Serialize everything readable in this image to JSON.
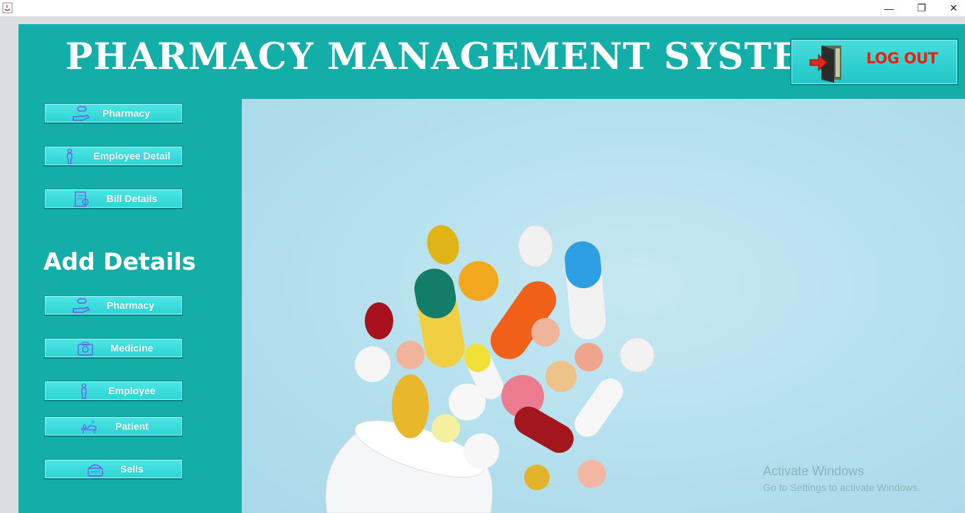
{
  "window": {
    "minimize_glyph": "—",
    "restore_glyph": "❐",
    "close_glyph": "✕"
  },
  "header": {
    "title": "PHARMACY MANAGEMENT SYSTEM",
    "logout_label": "LOG OUT"
  },
  "sidebar": {
    "items": [
      {
        "label": "Pharmacy",
        "icon": "pill-hand-icon"
      },
      {
        "label": "Employee Detail",
        "icon": "person-icon"
      },
      {
        "label": "Bill Details",
        "icon": "bill-icon"
      }
    ],
    "section_title": "Add Details",
    "add_items": [
      {
        "label": "Pharmacy",
        "icon": "pill-hand-icon"
      },
      {
        "label": "Medicine",
        "icon": "medicine-box-icon"
      },
      {
        "label": "Employee",
        "icon": "person-icon"
      },
      {
        "label": "Patient",
        "icon": "patient-bed-icon"
      },
      {
        "label": "Sells",
        "icon": "cash-register-icon"
      }
    ]
  },
  "watermark": {
    "line1": "Activate Windows",
    "line2": "Go to Settings to activate Windows."
  },
  "colors": {
    "panel": "#13aea8",
    "button": "#2fd3d3",
    "logout_text": "#e8200c",
    "photo_bg": "#b7e1ee"
  }
}
